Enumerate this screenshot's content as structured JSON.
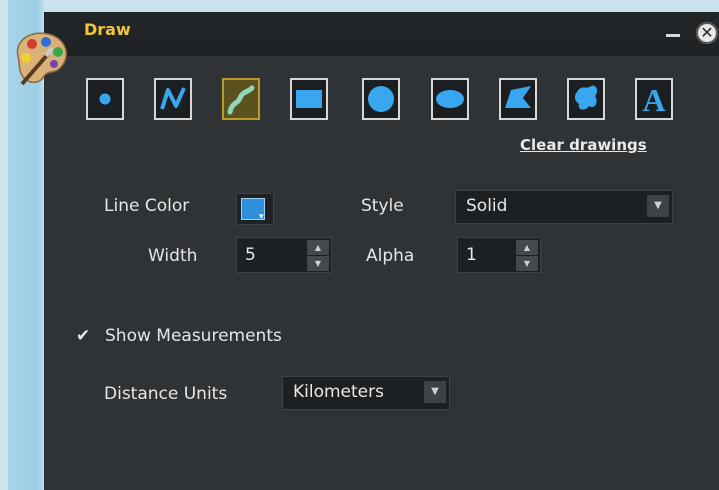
{
  "window": {
    "title": "Draw",
    "minimize_icon": "minimize-icon",
    "close_icon": "close-icon",
    "palette_icon": "paint-palette-icon"
  },
  "tools": [
    {
      "name": "point",
      "icon": "point-icon",
      "selected": false
    },
    {
      "name": "polyline",
      "icon": "polyline-icon",
      "selected": false
    },
    {
      "name": "freehand-line",
      "icon": "freehand-line-icon",
      "selected": true
    },
    {
      "name": "rectangle",
      "icon": "rectangle-icon",
      "selected": false
    },
    {
      "name": "circle",
      "icon": "circle-icon",
      "selected": false
    },
    {
      "name": "ellipse",
      "icon": "ellipse-icon",
      "selected": false
    },
    {
      "name": "polygon",
      "icon": "polygon-icon",
      "selected": false
    },
    {
      "name": "freehand-polygon",
      "icon": "freehand-polygon-icon",
      "selected": false
    },
    {
      "name": "text",
      "icon": "text-icon",
      "selected": false
    }
  ],
  "clear_drawings": "Clear drawings",
  "line_color": {
    "label": "Line Color",
    "color": "#2f8fd8"
  },
  "style": {
    "label": "Style",
    "value": "Solid"
  },
  "width": {
    "label": "Width",
    "value": "5"
  },
  "alpha": {
    "label": "Alpha",
    "value": "1"
  },
  "show_measurements": {
    "label": "Show Measurements",
    "checked": true
  },
  "distance_units": {
    "label": "Distance Units",
    "value": "Kilometers"
  },
  "colors": {
    "accent": "#f0c63a",
    "panel": "#2f3336",
    "selected_tool": "#5c5220"
  }
}
